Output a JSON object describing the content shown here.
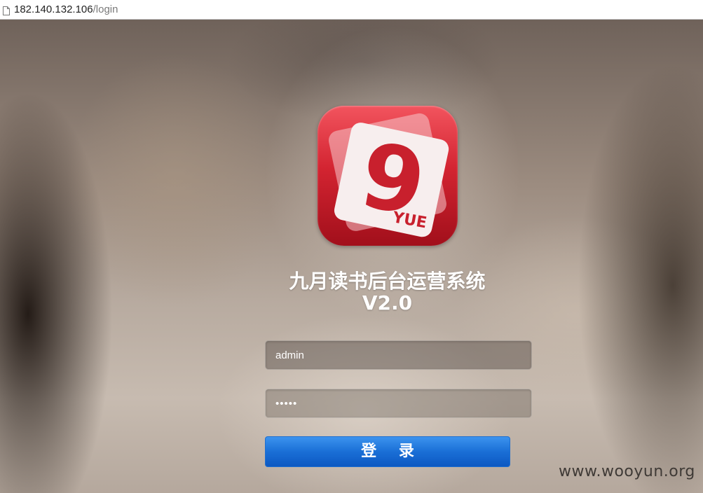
{
  "browser": {
    "url_host": "182.140.132.106",
    "url_path": "/login"
  },
  "logo": {
    "digit": "9",
    "brand_mark": "YUE",
    "icon": "app-logo-icon"
  },
  "login": {
    "title_line1": "九月读书后台运营系统",
    "title_line2": "V2.0",
    "username_value": "admin",
    "password_value": "•••••",
    "submit_label": "登 录"
  },
  "colors": {
    "logo_red": "#d32431",
    "button_blue": "#1a6fd6"
  },
  "watermark": "www.wooyun.org"
}
